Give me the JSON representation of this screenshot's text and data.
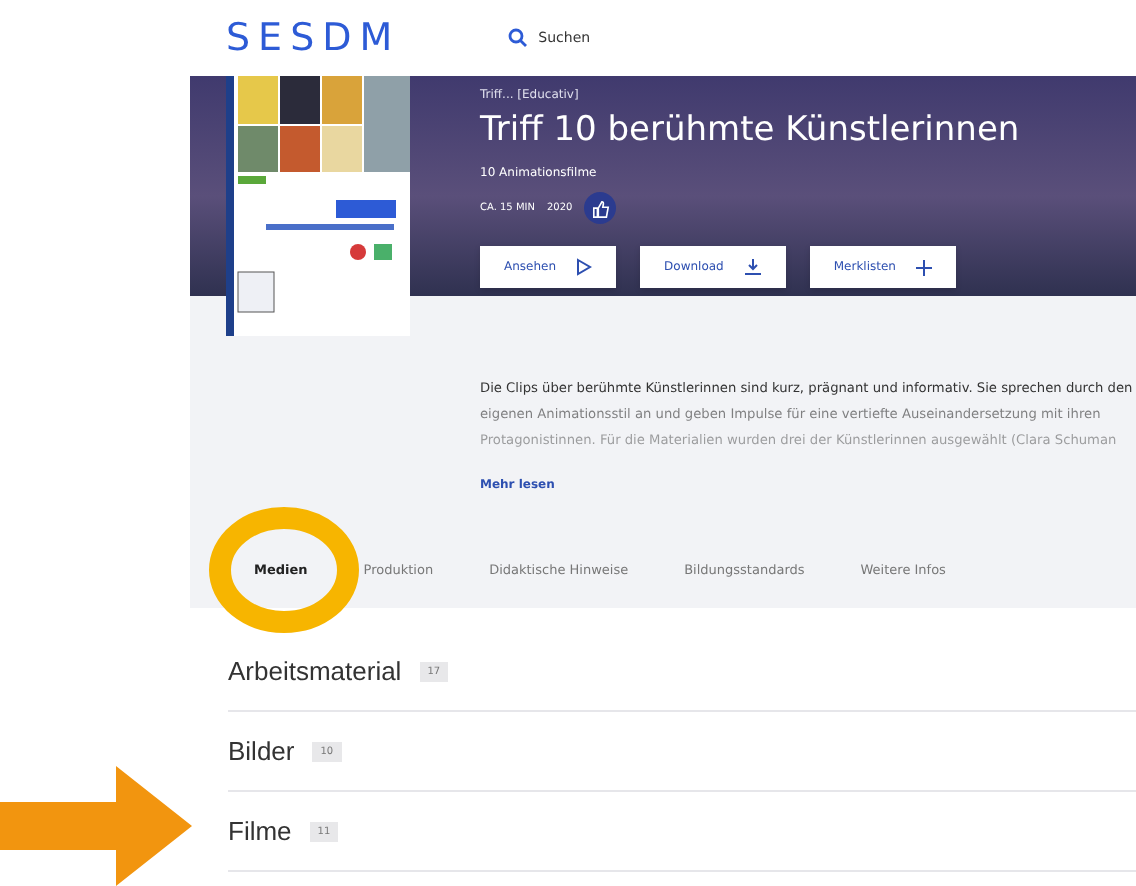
{
  "header": {
    "logo": "SESDM",
    "search": "Suchen"
  },
  "hero": {
    "breadcrumb": "Triff... [Educativ]",
    "title": "Triff 10 berühmte Künstlerinnen",
    "subtitle": "10 Animationsfilme",
    "duration": "CA. 15 MIN",
    "year": "2020"
  },
  "actions": [
    {
      "label": "Ansehen"
    },
    {
      "label": "Download"
    },
    {
      "label": "Merklisten"
    }
  ],
  "description": {
    "lines": [
      "Die Clips über berühmte Künstlerinnen sind kurz, prägnant und informativ. Sie sprechen durch den",
      "eigenen Animationsstil an und geben Impulse für eine vertiefte Auseinandersetzung mit ihren",
      "Protagonistinnen. Für die Materialien wurden drei der Künstlerinnen ausgewählt (Clara Schuman"
    ],
    "more": "Mehr lesen"
  },
  "tabs": [
    {
      "label": "Medien",
      "selected": true
    },
    {
      "label": "Produktion",
      "selected": false
    },
    {
      "label": "Didaktische Hinweise",
      "selected": false
    },
    {
      "label": "Bildungsstandards",
      "selected": false
    },
    {
      "label": "Weitere Infos",
      "selected": false
    }
  ],
  "sections": [
    {
      "label": "Arbeitsmaterial",
      "count": "17"
    },
    {
      "label": "Bilder",
      "count": "10"
    },
    {
      "label": "Filme",
      "count": "11"
    }
  ]
}
